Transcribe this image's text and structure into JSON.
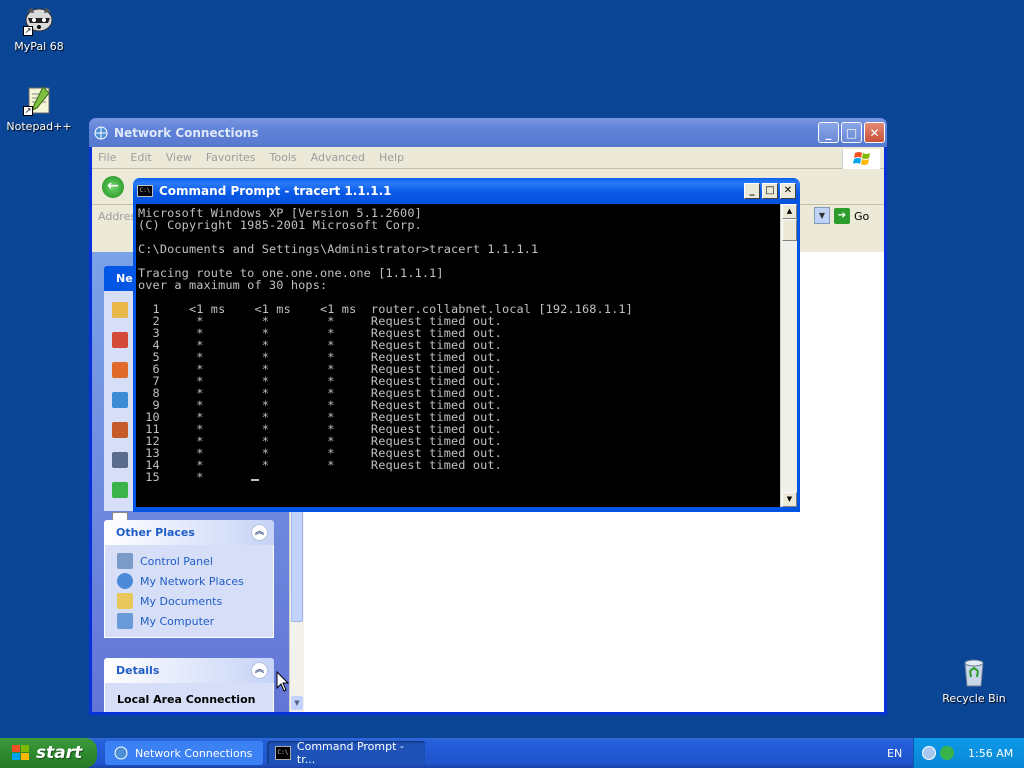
{
  "desktop": {
    "icons": [
      {
        "label": "MyPal 68"
      },
      {
        "label": "Notepad++"
      },
      {
        "label": "Recycle Bin"
      }
    ]
  },
  "network_window": {
    "title": "Network Connections",
    "menu": [
      "File",
      "Edit",
      "View",
      "Favorites",
      "Tools",
      "Advanced",
      "Help"
    ],
    "address_label": "Addres",
    "go_label": "Go",
    "other_places": {
      "title": "Other Places",
      "links": [
        "Control Panel",
        "My Network Places",
        "My Documents",
        "My Computer"
      ]
    },
    "details": {
      "title": "Details",
      "item": "Local Area Connection"
    },
    "tasks_header_partial": "Ne"
  },
  "cmd_window": {
    "title": "Command Prompt - tracert 1.1.1.1",
    "lines": [
      "Microsoft Windows XP [Version 5.1.2600]",
      "(C) Copyright 1985-2001 Microsoft Corp.",
      "",
      "C:\\Documents and Settings\\Administrator>tracert 1.1.1.1",
      "",
      "Tracing route to one.one.one.one [1.1.1.1]",
      "over a maximum of 30 hops:",
      "",
      "  1    <1 ms    <1 ms    <1 ms  router.collabnet.local [192.168.1.1]",
      "  2     *        *        *     Request timed out.",
      "  3     *        *        *     Request timed out.",
      "  4     *        *        *     Request timed out.",
      "  5     *        *        *     Request timed out.",
      "  6     *        *        *     Request timed out.",
      "  7     *        *        *     Request timed out.",
      "  8     *        *        *     Request timed out.",
      "  9     *        *        *     Request timed out.",
      " 10     *        *        *     Request timed out.",
      " 11     *        *        *     Request timed out.",
      " 12     *        *        *     Request timed out.",
      " 13     *        *        *     Request timed out.",
      " 14     *        *        *     Request timed out.",
      " 15     *"
    ]
  },
  "taskbar": {
    "start_label": "start",
    "buttons": [
      "Network Connections",
      "Command Prompt - tr..."
    ],
    "language": "EN",
    "clock": "1:56 AM"
  },
  "colors": {
    "desktop": "#0b4596",
    "console_bg": "#000000",
    "console_fg": "#c0c0c0",
    "link": "#215dc6"
  }
}
